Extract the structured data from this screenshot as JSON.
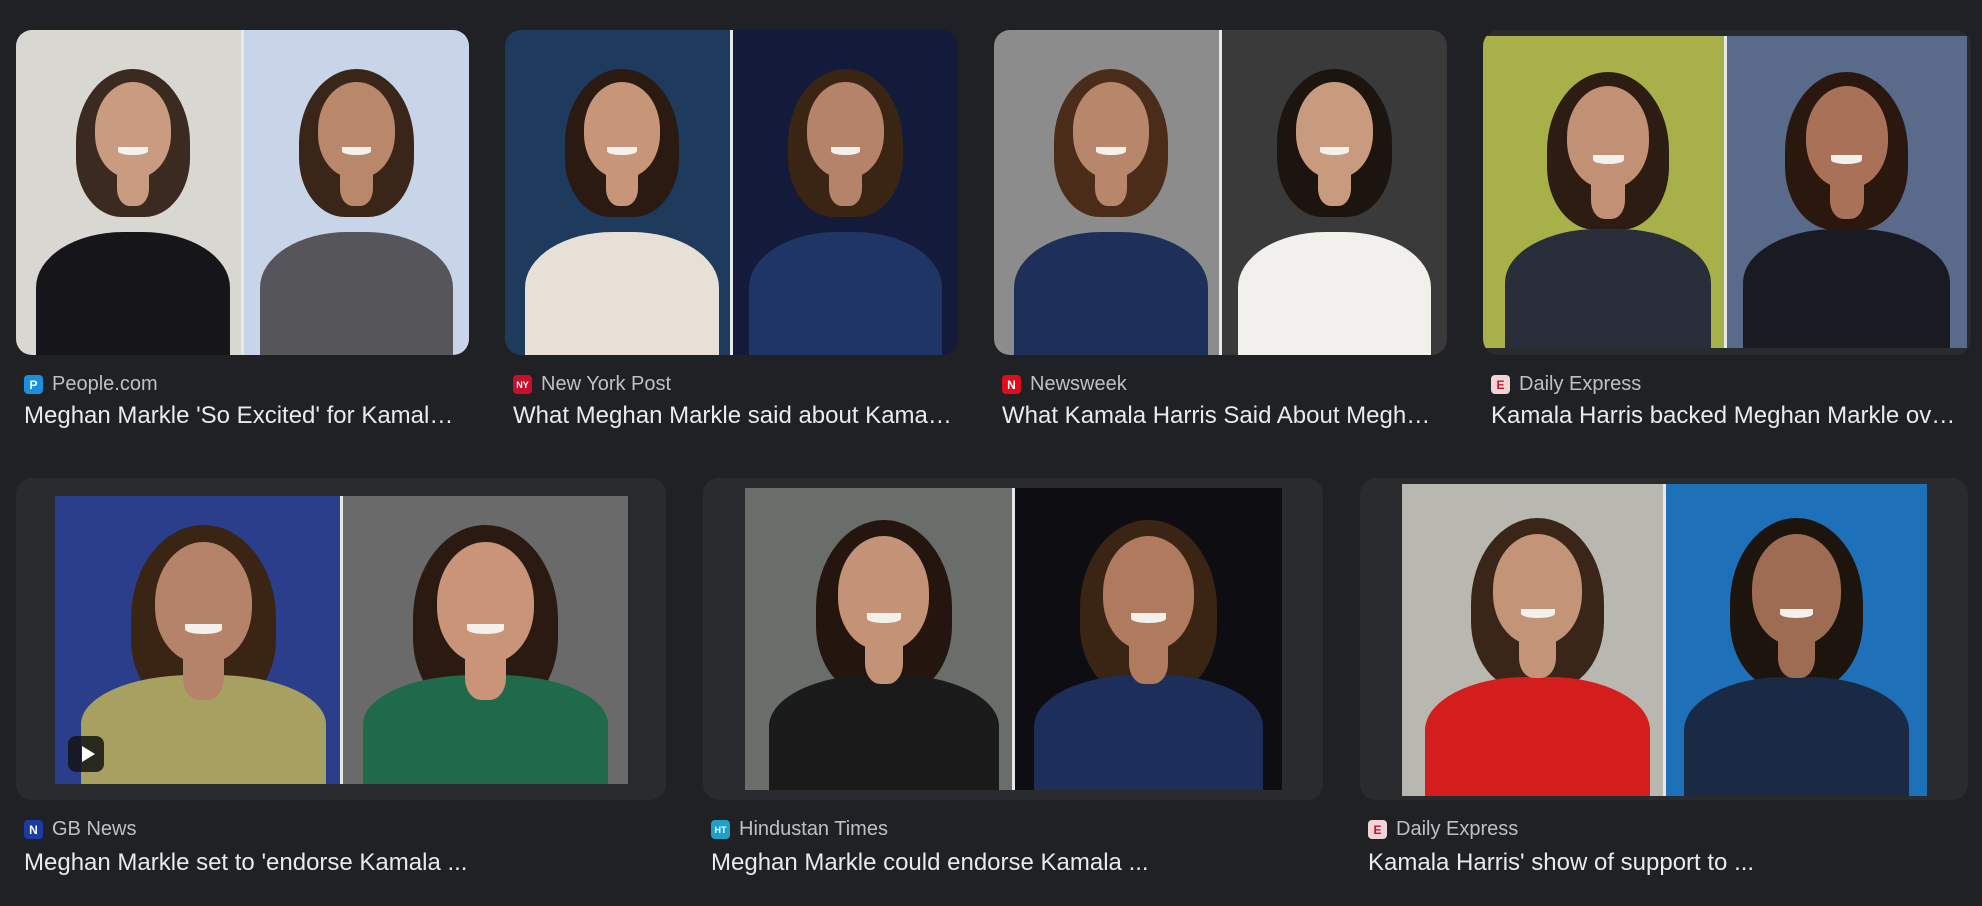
{
  "results": [
    {
      "source": "People.com",
      "favicon": {
        "name": "people-favicon-icon",
        "glyph": "P",
        "color": "#1a8fdc"
      },
      "title": "Meghan Markle 'So Excited' for Kamala Harris",
      "panes": [
        {
          "bg": "#d9d7d2",
          "hair": "#3b2a20",
          "skin": "#c99b80",
          "top": "#16161a"
        },
        {
          "bg": "#c8d4e8",
          "hair": "#3a2618",
          "skin": "#b9876a",
          "top": "#55555a"
        }
      ]
    },
    {
      "source": "New York Post",
      "favicon": {
        "name": "nypost-favicon-icon",
        "glyph": "NY",
        "color": "#c8102e"
      },
      "title": "What Meghan Markle said about Kamala Harris",
      "panes": [
        {
          "bg": "#1e3a5c",
          "hair": "#2a1a12",
          "skin": "#c79578",
          "top": "#e6e0d6"
        },
        {
          "bg": "#141a3a",
          "hair": "#3a2414",
          "skin": "#b5836a",
          "top": "#1f3566"
        }
      ]
    },
    {
      "source": "Newsweek",
      "favicon": {
        "name": "newsweek-favicon-icon",
        "glyph": "N",
        "color": "#e00b1c"
      },
      "title": "What Kamala Harris Said About Meghan Markle",
      "panes": [
        {
          "bg": "#8c8c8c",
          "hair": "#4a2c18",
          "skin": "#b8866a",
          "top": "#1e2f5a"
        },
        {
          "bg": "#3a3a3a",
          "hair": "#1c140e",
          "skin": "#c89a7e",
          "top": "#f2f0ec"
        }
      ]
    },
    {
      "source": "Daily Express",
      "favicon": {
        "name": "daily-express-favicon-icon",
        "glyph": "E",
        "color": "#f1d4d6"
      },
      "title": "Kamala Harris backed Meghan Markle over ...",
      "panes": [
        {
          "bg": "#a8b04a",
          "hair": "#2c1c12",
          "skin": "#c29074",
          "top": "#2a2e3a"
        },
        {
          "bg": "#5a6a8a",
          "hair": "#2a170e",
          "skin": "#a97258",
          "top": "#1a1a22"
        }
      ]
    },
    {
      "source": "GB News",
      "favicon": {
        "name": "gb-news-favicon-icon",
        "glyph": "N",
        "color": "#1a3aa8"
      },
      "title": "Meghan Markle set to 'endorse Kamala ...",
      "video": true,
      "panes": [
        {
          "bg": "#2a3e8c",
          "hair": "#3a2414",
          "skin": "#b5836a",
          "top": "#a8a060"
        },
        {
          "bg": "#6a6a6a",
          "hair": "#2a1a12",
          "skin": "#c99478",
          "top": "#1f6a4a"
        }
      ]
    },
    {
      "source": "Hindustan Times",
      "favicon": {
        "name": "hindustan-times-favicon-icon",
        "glyph": "HT",
        "color": "#1fa0c8"
      },
      "title": "Meghan Markle could endorse Kamala ...",
      "panes": [
        {
          "bg": "#6a6e6a",
          "hair": "#24160e",
          "skin": "#c49276",
          "top": "#1a1a1a"
        },
        {
          "bg": "#0e0e12",
          "hair": "#3a2414",
          "skin": "#b07a5e",
          "top": "#1e2e5a"
        }
      ]
    },
    {
      "source": "Daily Express",
      "favicon": {
        "name": "daily-express-favicon-icon",
        "glyph": "E",
        "color": "#f1d4d6"
      },
      "title": "Kamala Harris' show of support to ...",
      "panes": [
        {
          "bg": "#b8b8b0",
          "hair": "#3a2618",
          "skin": "#c49478",
          "top": "#d41e1e"
        },
        {
          "bg": "#1e70b8",
          "hair": "#1e140e",
          "skin": "#9e6c52",
          "top": "#1a2a44"
        }
      ]
    }
  ]
}
